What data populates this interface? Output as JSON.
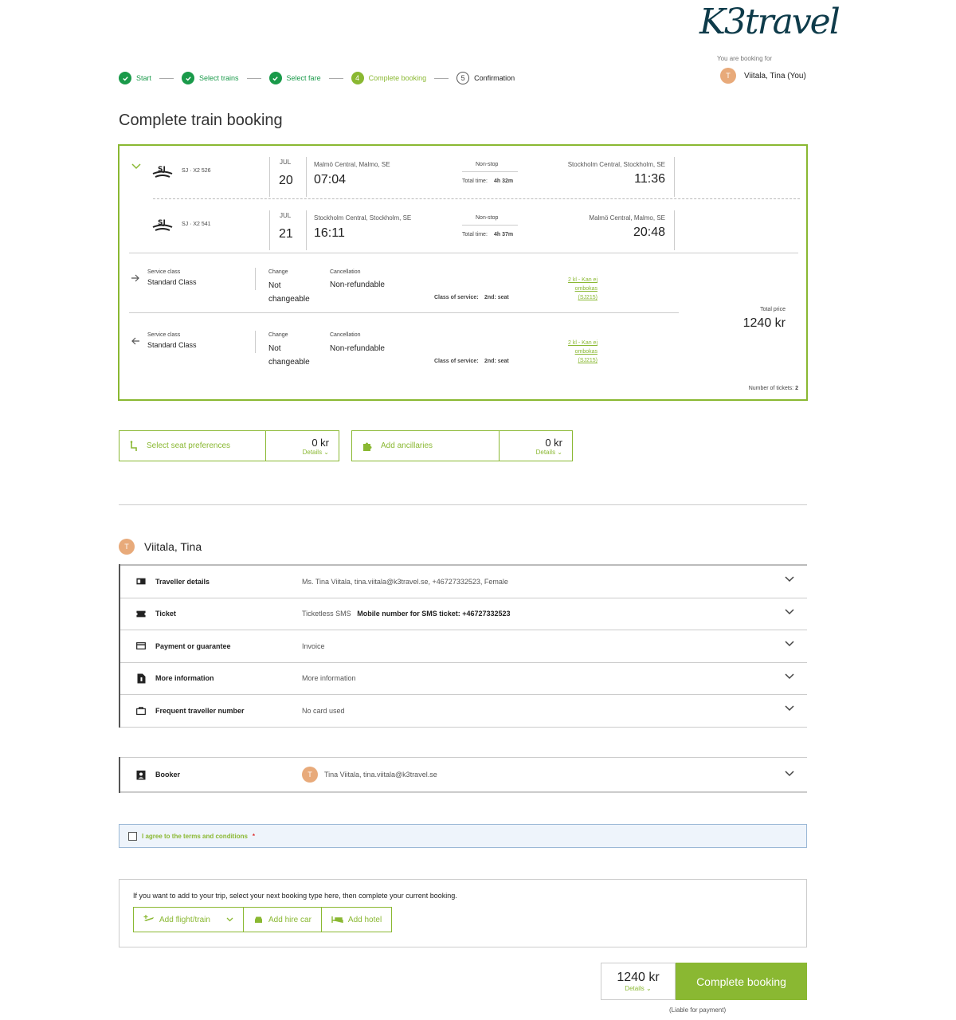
{
  "brand": {
    "logo_text": "K3travel"
  },
  "booking_for": {
    "label": "You are booking for",
    "initial": "T",
    "name": "Viitala, Tina (You)"
  },
  "steps": [
    {
      "num": "1",
      "label": "Start",
      "state": "done"
    },
    {
      "num": "2",
      "label": "Select trains",
      "state": "done"
    },
    {
      "num": "3",
      "label": "Select fare",
      "state": "done"
    },
    {
      "num": "4",
      "label": "Complete booking",
      "state": "current"
    },
    {
      "num": "5",
      "label": "Confirmation",
      "state": "todo"
    }
  ],
  "page_title": "Complete train booking",
  "legs": [
    {
      "carrier": "SJ",
      "train": "SJ · X2 526",
      "month": "JUL",
      "day": "20",
      "from": "Malmö Central, Malmo, SE",
      "dep_time": "07:04",
      "stops": "Non-stop",
      "total_label": "Total time:",
      "total_time": "4h 32m",
      "to": "Stockholm Central, Stockholm, SE",
      "arr_time": "11:36"
    },
    {
      "carrier": "SJ",
      "train": "SJ · X2 541",
      "month": "JUL",
      "day": "21",
      "from": "Stockholm Central, Stockholm, SE",
      "dep_time": "16:11",
      "stops": "Non-stop",
      "total_label": "Total time:",
      "total_time": "4h 37m",
      "to": "Malmö Central, Malmo, SE",
      "arr_time": "20:48"
    }
  ],
  "fares": [
    {
      "service_label": "Service class",
      "service": "Standard Class",
      "change_label": "Change",
      "change": "Not changeable",
      "cancel_label": "Cancellation",
      "cancel": "Non-refundable",
      "class_label": "Class of service:",
      "class": "2nd: seat",
      "link_lines": [
        "2 kl - Kan ej",
        "ombokas",
        "(SJ215)"
      ]
    },
    {
      "service_label": "Service class",
      "service": "Standard Class",
      "change_label": "Change",
      "change": "Not changeable",
      "cancel_label": "Cancellation",
      "cancel": "Non-refundable",
      "class_label": "Class of service:",
      "class": "2nd: seat",
      "link_lines": [
        "2 kl - Kan ej",
        "ombokas",
        "(SJ215)"
      ]
    }
  ],
  "total": {
    "label": "Total price",
    "price": "1240 kr",
    "tickets_label": "Number of tickets:",
    "tickets": "2"
  },
  "ancillaries": [
    {
      "label": "Select seat preferences",
      "price": "0 kr",
      "details": "Details"
    },
    {
      "label": "Add ancillaries",
      "price": "0 kr",
      "details": "Details"
    }
  ],
  "traveller": {
    "initial": "T",
    "name": "Viitala, Tina"
  },
  "details": [
    {
      "icon": "id-card-icon",
      "label": "Traveller details",
      "value": "Ms. Tina Viitala, tina.viitala@k3travel.se, +46727332523, Female",
      "value_bold": ""
    },
    {
      "icon": "ticket-icon",
      "label": "Ticket",
      "value": "Ticketless SMS",
      "value_bold": "Mobile number for SMS ticket: +46727332523"
    },
    {
      "icon": "credit-card-icon",
      "label": "Payment or guarantee",
      "value": "Invoice",
      "value_bold": ""
    },
    {
      "icon": "document-info-icon",
      "label": "More information",
      "value": "More information",
      "value_bold": ""
    },
    {
      "icon": "briefcase-icon",
      "label": "Frequent traveller number",
      "value": "No card used",
      "value_bold": ""
    }
  ],
  "booker": {
    "label": "Booker",
    "initial": "T",
    "value": "Tina Viitala, tina.viitala@k3travel.se"
  },
  "terms": {
    "label": "I agree to the terms and conditions",
    "required": "*"
  },
  "add_trip": {
    "text": "If you want to add to your trip, select your next booking type here, then complete your current booking.",
    "buttons": [
      "Add flight/train",
      "Add hire car",
      "Add hotel"
    ]
  },
  "footer": {
    "price": "1240 kr",
    "details": "Details",
    "complete": "Complete booking",
    "liable": "(Liable for payment)"
  },
  "colors": {
    "accent": "#8ab832",
    "done": "#1a9a4a",
    "avatar": "#e8aa7a"
  }
}
